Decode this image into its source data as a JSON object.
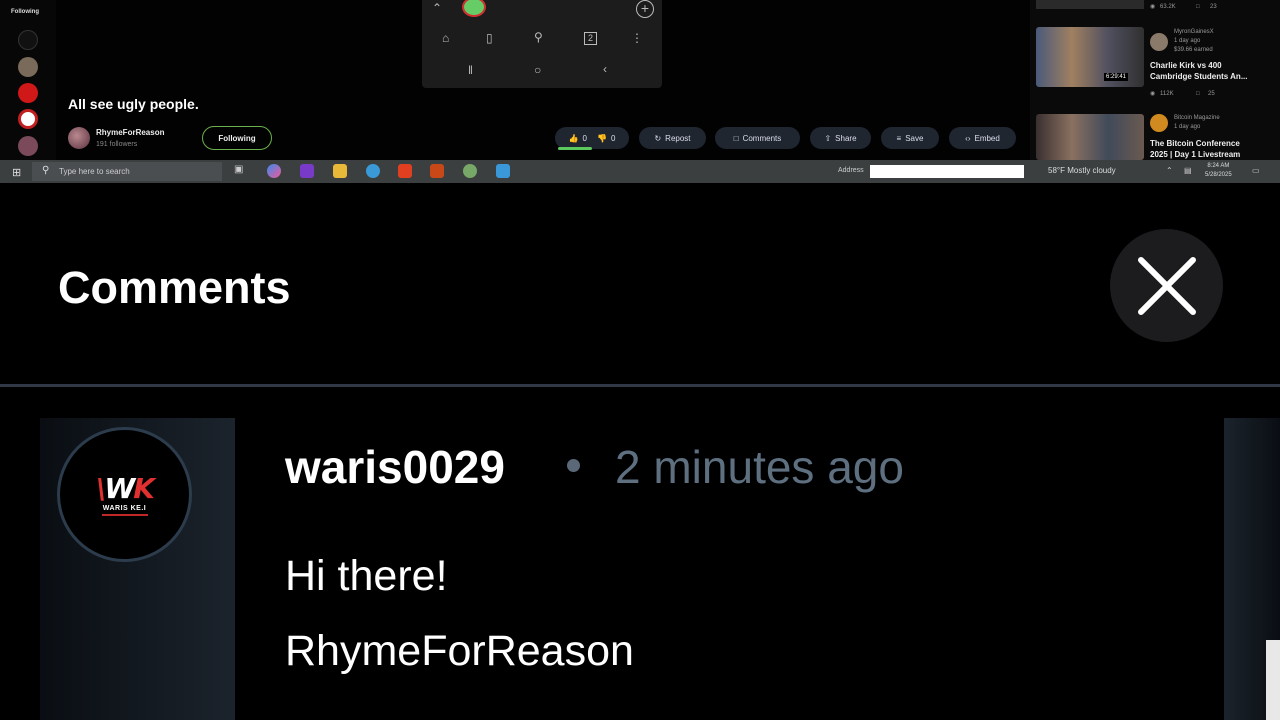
{
  "desktop": {
    "rail": {
      "title": "Following"
    },
    "post": {
      "title": "All see ugly people.",
      "author": "RhymeForReason",
      "followers": "191 followers",
      "following_label": "Following",
      "likes": "0",
      "dislikes": "0",
      "actions": [
        "Repost",
        "Comments",
        "Share",
        "Save",
        "Embed"
      ]
    },
    "sidebar": {
      "top_views": "63.2K",
      "top_comments": "23",
      "items": [
        {
          "channel": "MyronGainesX",
          "age": "1 day ago",
          "earned": "$39.66 earned",
          "title_line1": "Charlie Kirk vs 400",
          "title_line2": "Cambridge Students An...",
          "views": "112K",
          "comments": "25",
          "duration": "6:29:41"
        },
        {
          "channel": "Bitcoin Magazine",
          "age": "1 day ago",
          "title_line1": "The Bitcoin Conference",
          "title_line2": "2025 | Day 1 Livestream"
        }
      ]
    },
    "taskbar": {
      "search_placeholder": "Type here to search",
      "address_label": "Address",
      "weather": "58°F  Mostly cloudy",
      "time": "8:24 AM",
      "date": "5/28/2025"
    }
  },
  "comments": {
    "title": "Comments",
    "close_icon": "close-icon",
    "items": [
      {
        "username": "waris0029",
        "time": "2 minutes ago",
        "avatar_text": "WARIS KE.I",
        "lines": [
          "Hi there!",
          "RhymeForReason"
        ]
      }
    ]
  },
  "colors": {
    "background": "#000000",
    "divider": "#2f3844",
    "timestamp": "#5e6f80",
    "following_border": "#6ab04c"
  }
}
